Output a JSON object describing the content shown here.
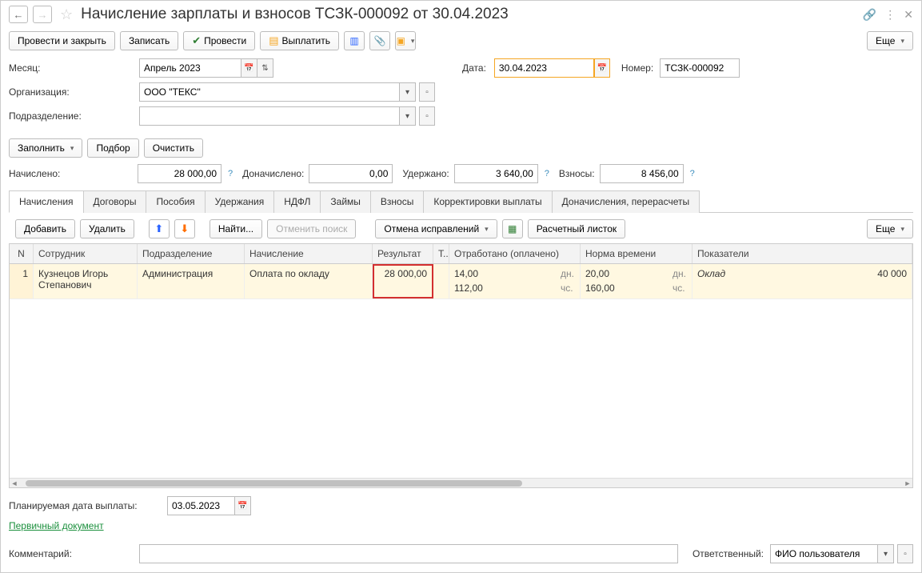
{
  "header": {
    "title": "Начисление зарплаты и взносов ТСЗК-000092 от 30.04.2023"
  },
  "toolbar": {
    "post_close": "Провести и закрыть",
    "write": "Записать",
    "post": "Провести",
    "pay": "Выплатить",
    "more": "Еще"
  },
  "form": {
    "month_label": "Месяц:",
    "month_value": "Апрель 2023",
    "date_label": "Дата:",
    "date_value": "30.04.2023",
    "number_label": "Номер:",
    "number_value": "ТСЗК-000092",
    "org_label": "Организация:",
    "org_value": "ООО \"ТЕКС\"",
    "dept_label": "Подразделение:",
    "dept_value": ""
  },
  "secondary": {
    "fill": "Заполнить",
    "select": "Подбор",
    "clear": "Очистить"
  },
  "totals": {
    "accrued_label": "Начислено:",
    "accrued_value": "28 000,00",
    "extra_label": "Доначислено:",
    "extra_value": "0,00",
    "withheld_label": "Удержано:",
    "withheld_value": "3 640,00",
    "contrib_label": "Взносы:",
    "contrib_value": "8 456,00"
  },
  "tabs": [
    "Начисления",
    "Договоры",
    "Пособия",
    "Удержания",
    "НДФЛ",
    "Займы",
    "Взносы",
    "Корректировки выплаты",
    "Доначисления, перерасчеты"
  ],
  "tab_toolbar": {
    "add": "Добавить",
    "delete": "Удалить",
    "find": "Найти...",
    "cancel_search": "Отменить поиск",
    "cancel_fix": "Отмена исправлений",
    "payslip": "Расчетный листок",
    "more": "Еще"
  },
  "columns": {
    "n": "N",
    "emp": "Сотрудник",
    "dept": "Подразделение",
    "accr": "Начисление",
    "res": "Результат",
    "t": "Т..",
    "worked": "Отработано (оплачено)",
    "norm": "Норма времени",
    "ind": "Показатели"
  },
  "rows": [
    {
      "n": "1",
      "emp": "Кузнецов Игорь Степанович",
      "dept": "Администрация",
      "accr": "Оплата по окладу",
      "res": "28 000,00",
      "worked_days": "14,00",
      "worked_hours": "112,00",
      "norm_days": "20,00",
      "norm_hours": "160,00",
      "unit_days": "дн.",
      "unit_hours": "чс.",
      "ind_name": "Оклад",
      "ind_value": "40 000"
    }
  ],
  "bottom": {
    "planned_label": "Планируемая дата выплаты:",
    "planned_value": "03.05.2023",
    "source_doc": "Первичный документ",
    "comment_label": "Комментарий:",
    "comment_value": "",
    "resp_label": "Ответственный:",
    "resp_value": "ФИО пользователя"
  }
}
